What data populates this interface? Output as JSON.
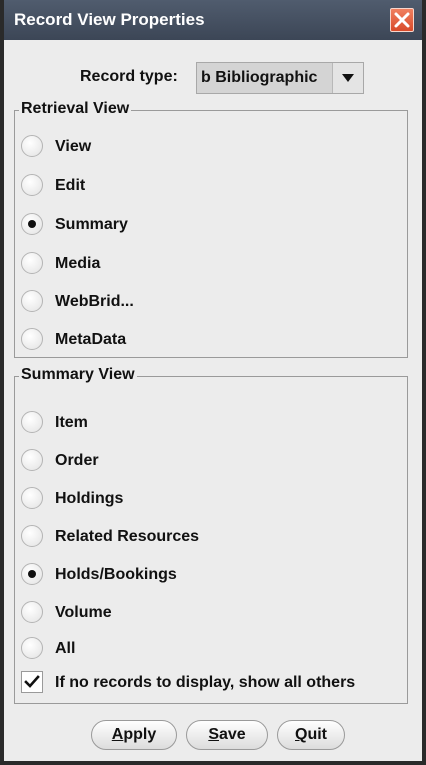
{
  "window": {
    "title": "Record View Properties"
  },
  "record_type": {
    "label": "Record type:",
    "selected": "b Bibliographic"
  },
  "retrieval_view": {
    "title": "Retrieval View",
    "options": [
      {
        "label": "View",
        "selected": false
      },
      {
        "label": "Edit",
        "selected": false
      },
      {
        "label": "Summary",
        "selected": true
      },
      {
        "label": "Media",
        "selected": false
      },
      {
        "label": "WebBrid...",
        "selected": false
      },
      {
        "label": "MetaData",
        "selected": false
      }
    ]
  },
  "summary_view": {
    "title": "Summary View",
    "options": [
      {
        "label": "Item",
        "selected": false
      },
      {
        "label": "Order",
        "selected": false
      },
      {
        "label": "Holdings",
        "selected": false
      },
      {
        "label": "Related Resources",
        "selected": false
      },
      {
        "label": "Holds/Bookings",
        "selected": true
      },
      {
        "label": "Volume",
        "selected": false
      },
      {
        "label": "All",
        "selected": false
      }
    ],
    "show_all_others": {
      "label": "If no records to display, show all others",
      "checked": true
    }
  },
  "buttons": {
    "apply_mnemonic": "A",
    "apply_rest": "pply",
    "save_mnemonic": "S",
    "save_rest": "ave",
    "quit_mnemonic": "Q",
    "quit_rest": "uit"
  }
}
